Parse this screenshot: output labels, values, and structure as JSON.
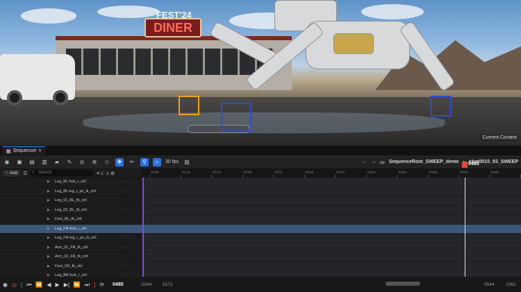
{
  "viewport": {
    "sign_top": "FEST'24",
    "sign_main": "DINER",
    "context_badge": "Current Context"
  },
  "tabs": [
    {
      "label": "Sequencer",
      "close": "×"
    }
  ],
  "toolbar": {
    "fps": "30 fps",
    "breadcrumb_root": "SequenceRoot_SWEEP_demo",
    "breadcrumb_shot": "shot0010_03_SWEEP"
  },
  "tracks_panel": {
    "add_label": "Add",
    "search_placeholder": "Search"
  },
  "ruler": {
    "ticks": [
      "0186",
      "0210",
      "0216",
      "0240",
      "0252",
      "0300",
      "0330",
      "0360",
      "0390",
      "0420",
      "0450",
      "0480",
      "0510"
    ],
    "playhead_frame": "0485"
  },
  "tracks": [
    {
      "label": "Leg_BL foot_r_ctrl",
      "selected": false
    },
    {
      "label": "Leg_BL leg_r_pv_ik_ctrl",
      "selected": false
    },
    {
      "label": "Leg_01_BL_fk_ctrl",
      "selected": false
    },
    {
      "label": "Leg_02_BL_fk_ctrl",
      "selected": false
    },
    {
      "label": "Foot_BL_fk_ctrl",
      "selected": false
    },
    {
      "label": "Leg_FR foot_r_ctrl",
      "selected": true
    },
    {
      "label": "Leg_FR leg_r_pv_ik_ctrl",
      "selected": false
    },
    {
      "label": "Arm_01_FR_fk_ctrl",
      "selected": false
    },
    {
      "label": "Arm_02_FR_fk_ctrl",
      "selected": false
    },
    {
      "label": "Foot_FR_fk_ctrl",
      "selected": false
    },
    {
      "label": "Leg_BR foot_r_ctrl",
      "selected": false
    }
  ],
  "transport": {
    "current_frame": "0485",
    "range_start": "-2544",
    "range_in": "0171",
    "range_out": "0544",
    "range_end": "1362"
  },
  "colors": {
    "accent": "#2b6fe3",
    "playhead": "#e04a3f",
    "selection": "#3b577a",
    "range_marker": "#7b4fd6"
  }
}
